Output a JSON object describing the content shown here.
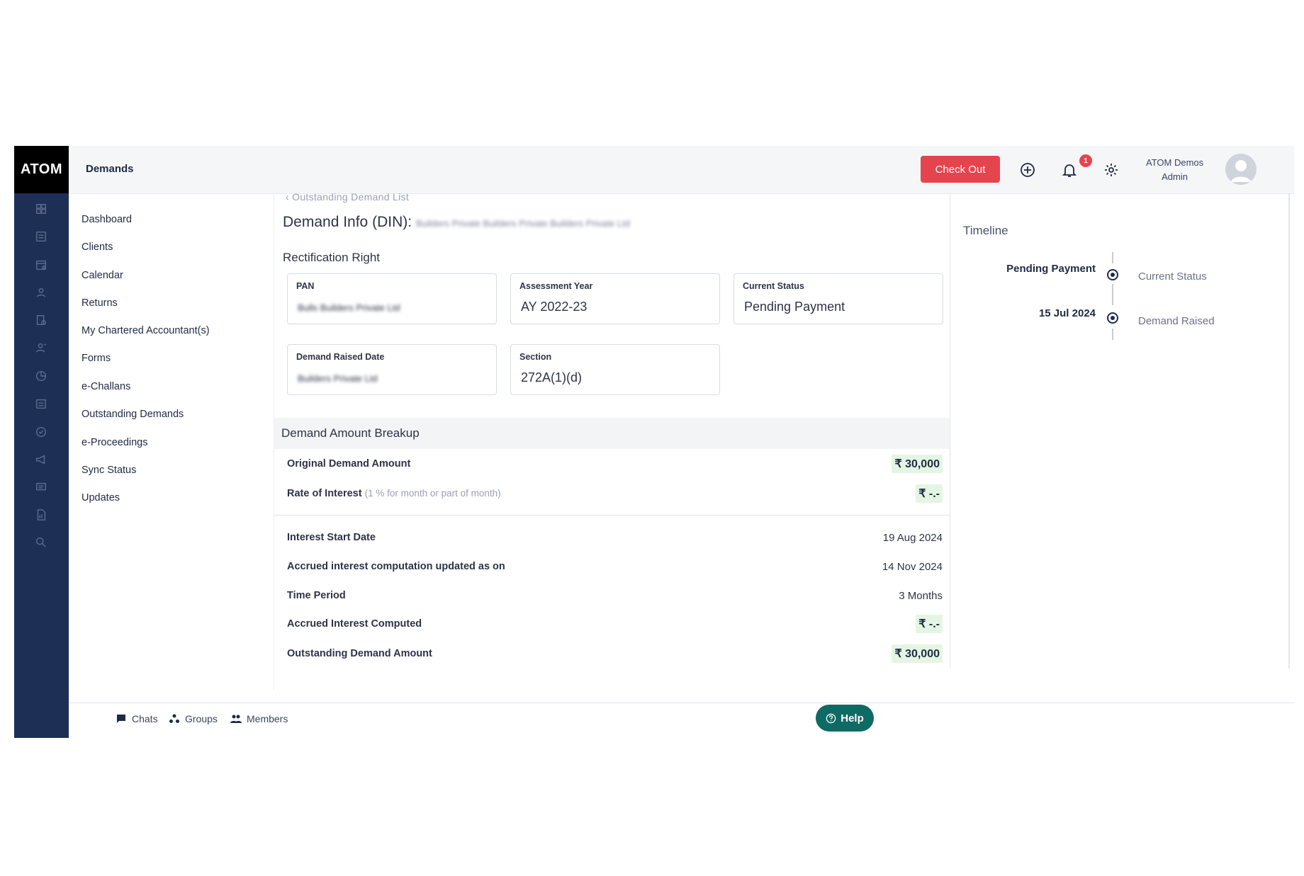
{
  "app": {
    "logo": "ATOM",
    "page_title": "Demands"
  },
  "header": {
    "checkout_label": "Check Out",
    "notification_count": "1",
    "user_name": "ATOM Demos",
    "user_role": "Admin"
  },
  "sidebar": {
    "items": [
      {
        "label": "Dashboard"
      },
      {
        "label": "Clients"
      },
      {
        "label": "Calendar"
      },
      {
        "label": "Returns"
      },
      {
        "label": "My Chartered Accountant(s)"
      },
      {
        "label": "Forms"
      },
      {
        "label": "e-Challans"
      },
      {
        "label": "Outstanding Demands"
      },
      {
        "label": "e-Proceedings"
      },
      {
        "label": "Sync Status"
      },
      {
        "label": "Updates"
      }
    ]
  },
  "main": {
    "breadcrumb": "Outstanding Demand List",
    "title": "Demand Info (DIN):",
    "din_value": "Builders Private Builders Private Builders Private Ltd",
    "subtitle": "Rectification Right",
    "cards": {
      "pan": {
        "label": "PAN",
        "value": "Bulls Builders Private Ltd"
      },
      "ay": {
        "label": "Assessment Year",
        "value": "AY 2022-23"
      },
      "status": {
        "label": "Current Status",
        "value": "Pending Payment"
      },
      "raised": {
        "label": "Demand Raised Date",
        "value": "Builders Private Ltd"
      },
      "section": {
        "label": "Section",
        "value": "272A(1)(d)"
      }
    },
    "breakup": {
      "heading": "Demand Amount Breakup",
      "original_label": "Original Demand Amount",
      "original_value": "₹ 30,000",
      "rate_label": "Rate of Interest",
      "rate_sub": "(1 % for month or part of month)",
      "rate_value": "₹ -.-",
      "start_label": "Interest Start Date",
      "start_value": "19 Aug 2024",
      "accrued_updated_label": "Accrued interest computation updated as on",
      "accrued_updated_value": "14 Nov 2024",
      "period_label": "Time Period",
      "period_value": "3 Months",
      "accrued_label": "Accrued Interest Computed",
      "accrued_value": "₹ -.-",
      "outstanding_label": "Outstanding Demand Amount",
      "outstanding_value": "₹ 30,000"
    }
  },
  "timeline": {
    "title": "Timeline",
    "events": [
      {
        "left": "Pending Payment",
        "right": "Current Status"
      },
      {
        "left": "15 Jul 2024",
        "right": "Demand Raised"
      }
    ]
  },
  "footer": {
    "chats": "Chats",
    "groups": "Groups",
    "members": "Members",
    "help": "Help"
  }
}
